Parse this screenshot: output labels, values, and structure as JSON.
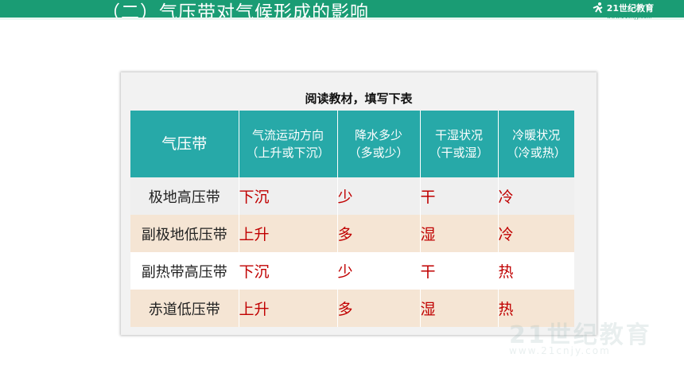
{
  "header": {
    "title": "（二）气压带对气候形成的影响",
    "logo_text": "21世纪教育",
    "logo_sub": "www.21cnjy.com"
  },
  "card": {
    "title": "阅读教材，填写下表"
  },
  "table": {
    "headers": [
      {
        "line1": "气压带",
        "line2": ""
      },
      {
        "line1": "气流运动方向",
        "line2": "（上升或下沉）"
      },
      {
        "line1": "降水多少",
        "line2": "（多或少）"
      },
      {
        "line1": "干湿状况",
        "line2": "（干或湿）"
      },
      {
        "line1": "冷暖状况",
        "line2": "（冷或热）"
      }
    ],
    "rows": [
      {
        "name": "极地高压带",
        "airflow": "下沉",
        "precip": "少",
        "humidity": "干",
        "temp": "冷"
      },
      {
        "name": "副极地低压带",
        "airflow": "上升",
        "precip": "多",
        "humidity": "湿",
        "temp": "冷"
      },
      {
        "name": "副热带高压带",
        "airflow": "下沉",
        "precip": "少",
        "humidity": "干",
        "temp": "热"
      },
      {
        "name": "赤道低压带",
        "airflow": "上升",
        "precip": "多",
        "humidity": "湿",
        "temp": "热"
      }
    ]
  },
  "watermark": {
    "text": "21世纪教育",
    "sub": "www.21cnjy.com"
  },
  "colors": {
    "banner": "#1a9c74",
    "header_bg": "#27a9a8",
    "answer_text": "#c00000",
    "row_alt": "#f5e5d4"
  }
}
